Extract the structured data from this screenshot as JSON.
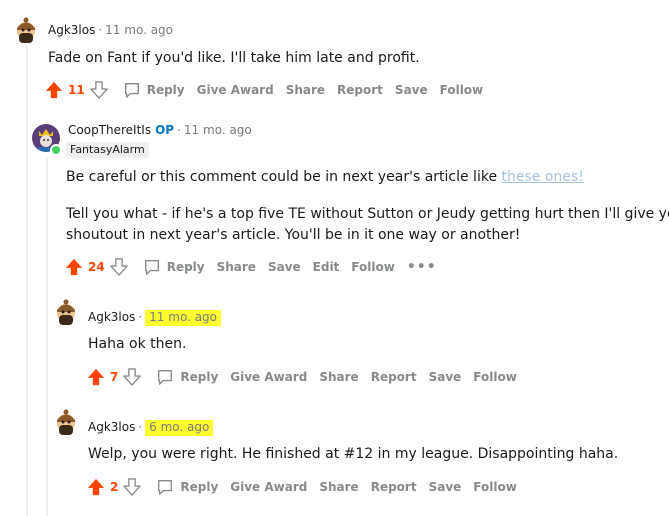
{
  "comments": [
    {
      "username": "Agk3los",
      "time": "11 mo. ago",
      "body": [
        "Fade on Fant if you'd like. I'll take him late and profit."
      ],
      "score": "11",
      "actions": {
        "reply": "Reply",
        "award": "Give Award",
        "share": "Share",
        "report": "Report",
        "save": "Save",
        "follow": "Follow"
      }
    },
    {
      "username": "CoopThereItIs",
      "op_badge": "OP",
      "time": "11 mo. ago",
      "flair": "FantasyAlarm",
      "body_p1_prefix": "Be careful or this comment could be in next year's article like ",
      "body_p1_link": "these ones!",
      "body_p2_line1": "Tell you what - if he's a top five TE without Sutton or Jeudy getting hurt then I'll give you a",
      "body_p2_line2": "shoutout in next year's article. You'll be in it one way or another!",
      "score": "24",
      "actions": {
        "reply": "Reply",
        "share": "Share",
        "save": "Save",
        "edit": "Edit",
        "follow": "Follow",
        "more": "•••"
      }
    },
    {
      "username": "Agk3los",
      "time": "11 mo. ago",
      "body": [
        "Haha ok then."
      ],
      "score": "7",
      "actions": {
        "reply": "Reply",
        "award": "Give Award",
        "share": "Share",
        "report": "Report",
        "save": "Save",
        "follow": "Follow"
      }
    },
    {
      "username": "Agk3los",
      "time": "6 mo. ago",
      "body": [
        "Welp, you were right. He finished at #12 in my league. Disappointing haha."
      ],
      "score": "2",
      "actions": {
        "reply": "Reply",
        "award": "Give Award",
        "share": "Share",
        "report": "Report",
        "save": "Save",
        "follow": "Follow"
      }
    }
  ],
  "colors": {
    "upvote": "#ff4500",
    "highlight": "#ffff2e",
    "op": "#0079d3",
    "online": "#46d160"
  },
  "icons": [
    "upvote-arrow-icon",
    "downvote-arrow-icon",
    "comment-bubble-icon",
    "snoo-avatar-icon",
    "king-avatar-icon"
  ]
}
